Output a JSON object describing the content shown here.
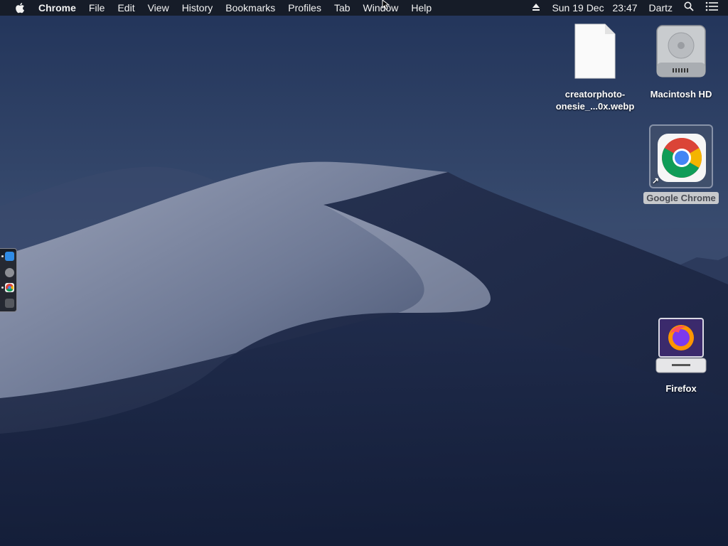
{
  "menubar": {
    "apple": "apple-logo-icon",
    "app_name": "Chrome",
    "menus": [
      "File",
      "Edit",
      "View",
      "History",
      "Bookmarks",
      "Profiles",
      "Tab",
      "Window",
      "Help"
    ],
    "eject_icon": "eject-icon",
    "date": "Sun 19 Dec",
    "time": "23:47",
    "user": "Dartz",
    "search_icon": "spotlight-search-icon",
    "notification_icon": "notification-center-icon"
  },
  "desktop": {
    "items": [
      {
        "label_line1": "creatorphoto-",
        "label_line2": "onesie_...0x.webp",
        "icon": "document-icon"
      },
      {
        "label": "Macintosh HD",
        "icon": "hard-drive-icon"
      },
      {
        "label": "Google Chrome",
        "icon": "chrome-icon",
        "selected": true
      },
      {
        "label": "Firefox",
        "icon": "firefox-disk-icon"
      }
    ]
  },
  "dock": {
    "apps": [
      "finder-icon",
      "system-preferences-icon",
      "chrome-icon",
      "trash-icon"
    ]
  },
  "colors": {
    "menubar_bg": "#161a24",
    "sky": "#1c2b4c",
    "dune_light": "#8a93ab",
    "selection_label_bg": "#c7c9cc"
  }
}
